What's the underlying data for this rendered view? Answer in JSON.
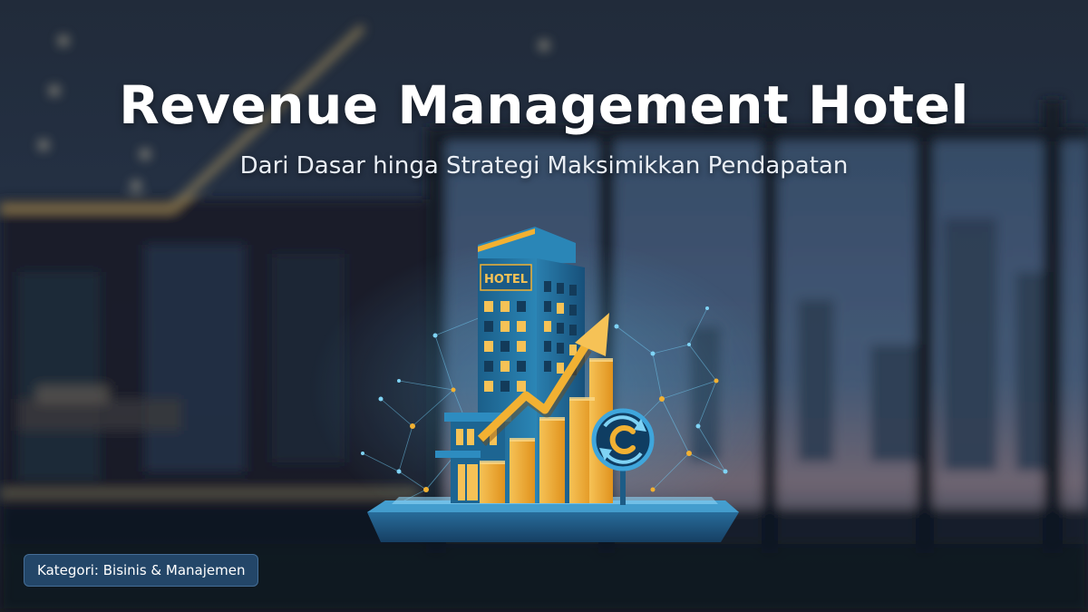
{
  "slide": {
    "title": "Revenue Management Hotel",
    "subtitle": "Dari Dasar hinga Strategi Maksimikkan Pendapatan",
    "category": "Kategori: Bisinis & Manajemen"
  },
  "illustration": {
    "building_sign": "HOTEL",
    "icons": [
      "hotel-building-icon",
      "growth-arrow-icon",
      "bar-chart-icon",
      "currency-refresh-icon",
      "network-dots-icon"
    ]
  },
  "colors": {
    "accent_gold": "#f2b132",
    "building_blue": "#1f6d9a",
    "badge_bg": "#285078"
  }
}
